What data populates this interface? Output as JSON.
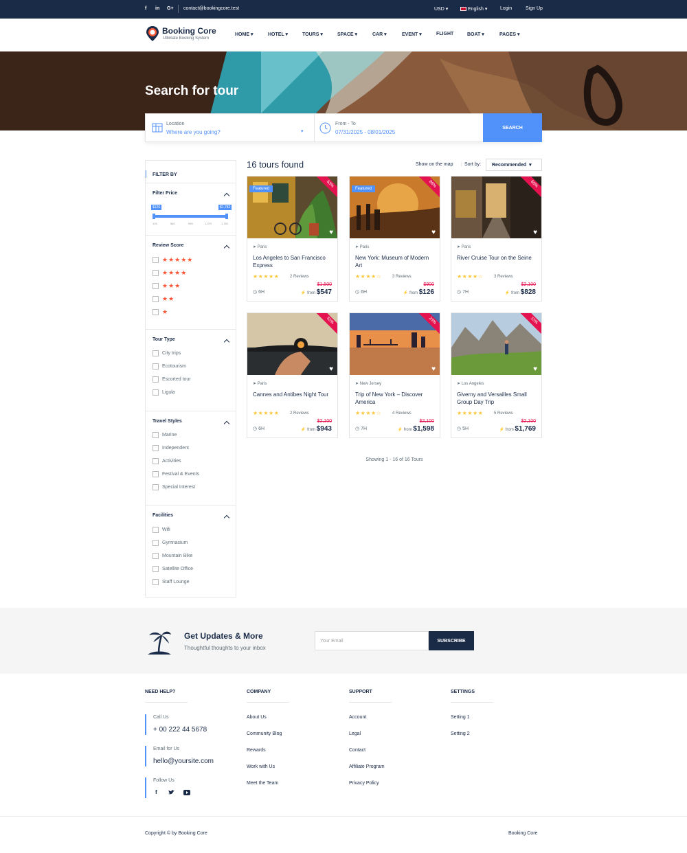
{
  "topbar": {
    "social": [
      "f",
      "in",
      "G+"
    ],
    "email": "contact@bookingcore.test",
    "currency": "USD",
    "language": "English",
    "login": "Login",
    "signup": "Sign Up"
  },
  "brand": {
    "title": "Booking Core",
    "subtitle": "Ultimate Booking System"
  },
  "nav": {
    "items": [
      "HOME",
      "HOTEL",
      "TOURS",
      "SPACE",
      "CAR",
      "EVENT",
      "FLIGHT",
      "BOAT",
      "PAGES"
    ]
  },
  "hero": {
    "title": "Search for tour"
  },
  "search": {
    "location_label": "Location",
    "location_value": "Where are you going?",
    "date_label": "From - To",
    "date_value": "07/31/2025 - 08/01/2025",
    "button": "SEARCH"
  },
  "filter": {
    "title": "FILTER BY",
    "price": {
      "title": "Filter Price",
      "min_label": "$126",
      "max_label": "$1,782",
      "ticks": [
        "126",
        "540",
        "955",
        "1,370",
        "1,782"
      ]
    },
    "review": {
      "title": "Review Score",
      "levels": [
        5,
        4,
        3,
        2,
        1
      ]
    },
    "tour_type": {
      "title": "Tour Type",
      "items": [
        "City trips",
        "Ecotourism",
        "Escorted tour",
        "Ligula"
      ]
    },
    "travel_styles": {
      "title": "Travel Styles",
      "items": [
        "Marine",
        "Independent",
        "Activities",
        "Festival & Events",
        "Special Interest"
      ]
    },
    "facilities": {
      "title": "Facilities",
      "items": [
        "Wifi",
        "Gymnasium",
        "Mountain Bike",
        "Satellite Office",
        "Staff Lounge"
      ]
    }
  },
  "results": {
    "count_text": "16 tours found",
    "map_link": "Show on the map",
    "sort_label": "Sort by:",
    "sort_value": "Recommended",
    "showing": "Showing 1 - 16 of 16 Tours"
  },
  "tours": [
    {
      "location": "Paris",
      "title": "Los Angeles to San Francisco Express",
      "rating": 5,
      "reviews": "2 Reviews",
      "duration": "6H",
      "old_price": "$1,500",
      "price_prefix": "from",
      "price": "$547",
      "discount": "63%",
      "featured": "Featured"
    },
    {
      "location": "Paris",
      "title": "New York: Museum of Modern Art",
      "rating": 4,
      "reviews": "3 Reviews",
      "duration": "6H",
      "old_price": "$900",
      "price_prefix": "from",
      "price": "$126",
      "discount": "86%",
      "featured": "Featured"
    },
    {
      "location": "Paris",
      "title": "River Cruise Tour on the Seine",
      "rating": 4,
      "reviews": "3 Reviews",
      "duration": "7H",
      "old_price": "$2,100",
      "price_prefix": "from",
      "price": "$828",
      "discount": "60%",
      "featured": ""
    },
    {
      "location": "Paris",
      "title": "Cannes and Antibes Night Tour",
      "rating": 5,
      "reviews": "2 Reviews",
      "duration": "6H",
      "old_price": "$2,100",
      "price_prefix": "from",
      "price": "$943",
      "discount": "55%",
      "featured": ""
    },
    {
      "location": "New Jersey",
      "title": "Trip of New York – Discover America",
      "rating": 4.5,
      "reviews": "4 Reviews",
      "duration": "7H",
      "old_price": "$2,100",
      "price_prefix": "from",
      "price": "$1,598",
      "discount": "23%",
      "featured": ""
    },
    {
      "location": "Los Angeles",
      "title": "Giverny and Versailles Small Group Day Trip",
      "rating": 5,
      "reviews": "5 Reviews",
      "duration": "5H",
      "old_price": "$2,100",
      "price_prefix": "from",
      "price": "$1,769",
      "discount": "15%",
      "featured": ""
    }
  ],
  "newsletter": {
    "title": "Get Updates & More",
    "subtitle": "Thoughtful thoughts to your inbox",
    "placeholder": "Your Email",
    "button": "SUBSCRIBE"
  },
  "footer": {
    "help": {
      "title": "NEED HELP?",
      "call_label": "Call Us",
      "phone": "+ 00 222 44 5678",
      "email_label": "Email for Us",
      "email": "hello@yoursite.com",
      "follow_label": "Follow Us"
    },
    "company": {
      "title": "COMPANY",
      "links": [
        "About Us",
        "Community Blog",
        "Rewards",
        "Work with Us",
        "Meet the Team"
      ]
    },
    "support": {
      "title": "SUPPORT",
      "links": [
        "Account",
        "Legal",
        "Contact",
        "Affiliate Program",
        "Privacy Policy"
      ]
    },
    "settings": {
      "title": "SETTINGS",
      "links": [
        "Setting 1",
        "Setting 2"
      ]
    },
    "copyright": "Copyright © by Booking Core",
    "brand": "Booking Core"
  },
  "colors": {
    "primary": "#5191fa",
    "navy": "#1a2b48",
    "discount": "#e4134f",
    "star": "#fac73e",
    "review_star": "#fa5636"
  }
}
